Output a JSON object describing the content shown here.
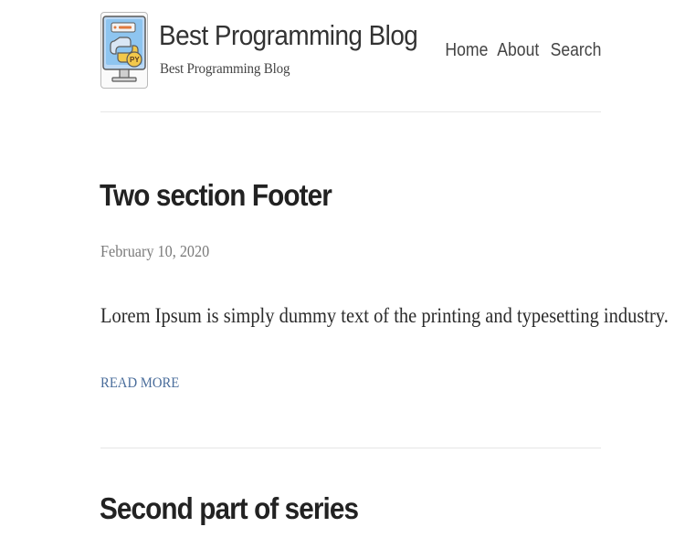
{
  "site": {
    "title": "Best Programming Blog",
    "tagline": "Best Programming Blog",
    "logo_icon": "python-monitor-logo-icon"
  },
  "nav": {
    "home": "Home",
    "about": "About",
    "search": "Search"
  },
  "posts": [
    {
      "title": "Two section Footer",
      "date": "February 10, 2020",
      "excerpt": "Lorem Ipsum is simply dummy text of the printing and typesetting industry.",
      "read_more": "READ MORE"
    },
    {
      "title": "Second part of series"
    }
  ],
  "colors": {
    "link": "#4a6d9b",
    "divider": "#e6e6e6",
    "date": "#7a7a7a"
  }
}
